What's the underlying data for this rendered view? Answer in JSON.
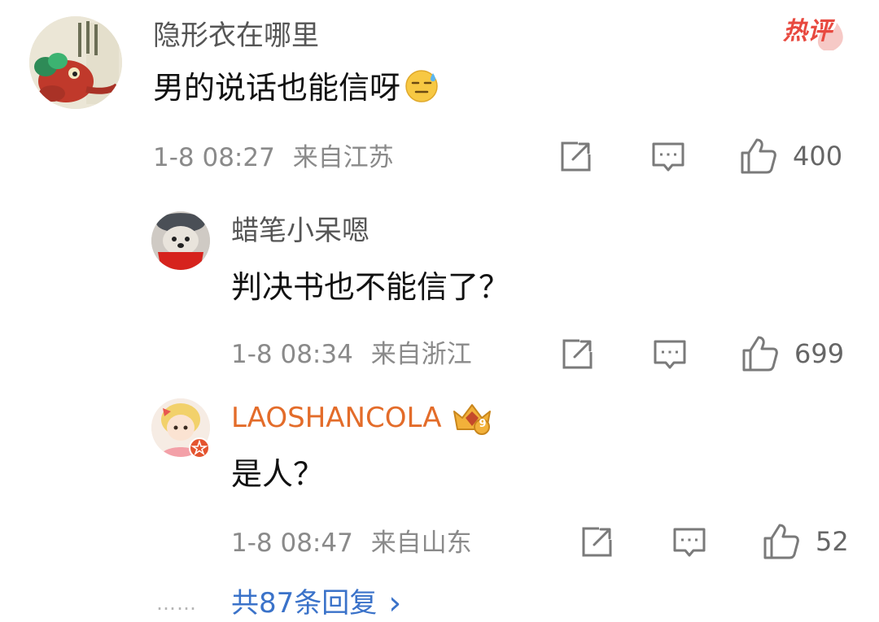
{
  "comments": [
    {
      "username": "隐形衣在哪里",
      "text": "男的说话也能信呀",
      "emoji": "sweat-smile-icon",
      "time": "1-8 08:27",
      "location": "来自江苏",
      "likes": "400",
      "hot_badge": "热评"
    }
  ],
  "replies": [
    {
      "username": "蜡笔小呆嗯",
      "text": "判决书也不能信了？",
      "time": "1-8 08:34",
      "location": "来自浙江",
      "likes": "699"
    },
    {
      "username": "LAOSHANCOLA",
      "text": "是人？",
      "time": "1-8 08:47",
      "location": "来自山东",
      "likes": "52",
      "badge_level": "9",
      "username_color": "#e36c2a"
    }
  ],
  "more_replies": {
    "dots": "……",
    "label": "共87条回复",
    "arrow": "›"
  },
  "colors": {
    "hot_badge": "#e8493f",
    "link": "#3a72c9",
    "meta": "#8a8a8a"
  }
}
